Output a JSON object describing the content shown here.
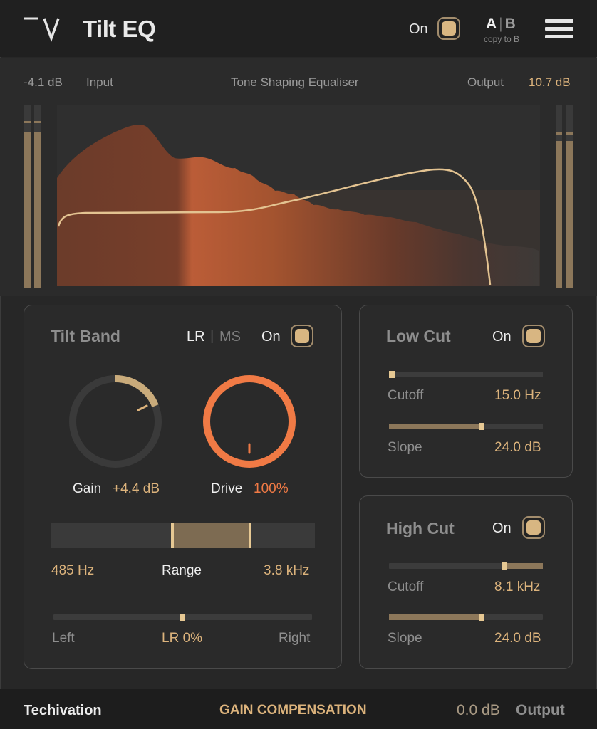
{
  "header": {
    "title": "Tilt EQ",
    "on_label": "On",
    "ab_a": "A",
    "ab_sep": "|",
    "ab_b": "B",
    "copy_label": "copy to B",
    "power_on": true
  },
  "display": {
    "input_value": "-4.1 dB",
    "input_label": "Input",
    "center_label": "Tone Shaping Equaliser",
    "output_label": "Output",
    "output_value": "10.7 dB"
  },
  "tilt_band": {
    "title": "Tilt Band",
    "mode_lr": "LR",
    "mode_sep": "|",
    "mode_ms": "MS",
    "on_label": "On",
    "gain_label": "Gain",
    "gain_value": "+4.4 dB",
    "drive_label": "Drive",
    "drive_value": "100%",
    "range_low": "485 Hz",
    "range_label": "Range",
    "range_high": "3.8 kHz",
    "pan_left": "Left",
    "pan_value": "LR 0%",
    "pan_right": "Right"
  },
  "low_cut": {
    "title": "Low Cut",
    "on_label": "On",
    "cutoff_label": "Cutoff",
    "cutoff_value": "15.0 Hz",
    "slope_label": "Slope",
    "slope_value": "24.0 dB"
  },
  "high_cut": {
    "title": "High Cut",
    "on_label": "On",
    "cutoff_label": "Cutoff",
    "cutoff_value": "8.1 kHz",
    "slope_label": "Slope",
    "slope_value": "24.0 dB"
  },
  "footer": {
    "brand": "Techivation",
    "gain_comp": "GAIN COMPENSATION",
    "output_value": "0.0 dB",
    "output_label": "Output"
  },
  "colors": {
    "accent": "#dcb37c",
    "drive": "#f07a45",
    "spectrum": "#b8643e"
  }
}
